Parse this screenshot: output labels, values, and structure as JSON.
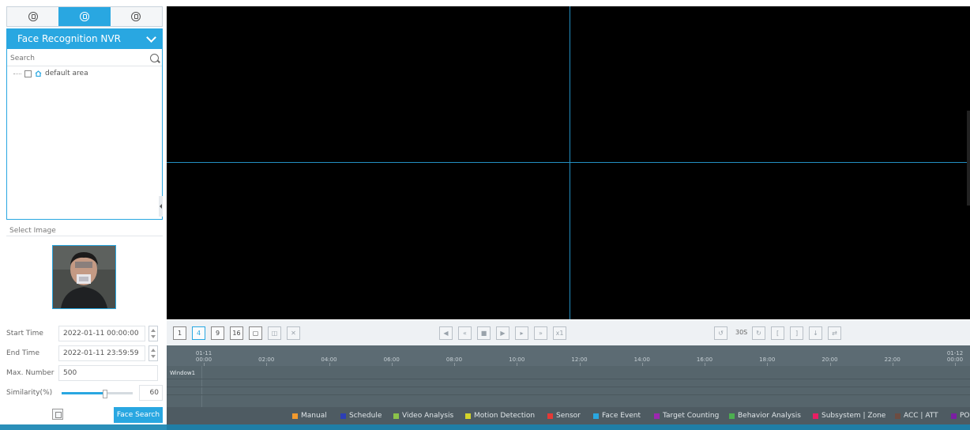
{
  "tabs": [
    {
      "icon": "camera-icon",
      "active": false
    },
    {
      "icon": "face-icon",
      "active": true
    },
    {
      "icon": "settings-icon",
      "active": false
    }
  ],
  "device": {
    "title": "Face Recognition NVR"
  },
  "search": {
    "placeholder": "Search"
  },
  "tree": {
    "area_label": "default area"
  },
  "select_image": {
    "label": "Select Image"
  },
  "form": {
    "start_label": "Start Time",
    "start_value": "2022-01-11 00:00:00",
    "end_label": "End Time",
    "end_value": "2022-01-11 23:59:59",
    "max_label": "Max. Number",
    "max_value": "500",
    "sim_label": "Similarity(%)",
    "sim_value": "60",
    "sim_level": 0.6
  },
  "face_search_button": "Face Search",
  "toolbar": {
    "layouts": [
      "1",
      "4",
      "9",
      "16"
    ],
    "speed": "x1",
    "interval": "30S"
  },
  "timeline": {
    "ticks": [
      {
        "date": "01-11",
        "time": "00:00"
      },
      {
        "date": "",
        "time": "02:00"
      },
      {
        "date": "",
        "time": "04:00"
      },
      {
        "date": "",
        "time": "06:00"
      },
      {
        "date": "",
        "time": "08:00"
      },
      {
        "date": "",
        "time": "10:00"
      },
      {
        "date": "",
        "time": "12:00"
      },
      {
        "date": "",
        "time": "14:00"
      },
      {
        "date": "",
        "time": "16:00"
      },
      {
        "date": "",
        "time": "18:00"
      },
      {
        "date": "",
        "time": "20:00"
      },
      {
        "date": "",
        "time": "22:00"
      },
      {
        "date": "01-12",
        "time": "00:00"
      }
    ],
    "window_label": "Window1"
  },
  "legend": [
    {
      "label": "Manual",
      "color": "#f29a2e"
    },
    {
      "label": "Schedule",
      "color": "#2d3fb5"
    },
    {
      "label": "Video Analysis",
      "color": "#8bc34a"
    },
    {
      "label": "Motion Detection",
      "color": "#d4d42a"
    },
    {
      "label": "Sensor",
      "color": "#e53935"
    },
    {
      "label": "Face Event",
      "color": "#29a7e1"
    },
    {
      "label": "Target Counting",
      "color": "#9c27b0"
    },
    {
      "label": "Behavior Analysis",
      "color": "#4caf50"
    },
    {
      "label": "Subsystem | Zone",
      "color": "#e91e63"
    },
    {
      "label": "ACC | ATT",
      "color": "#6d4c41"
    },
    {
      "label": "PO",
      "color": "#7b1fa2"
    }
  ]
}
